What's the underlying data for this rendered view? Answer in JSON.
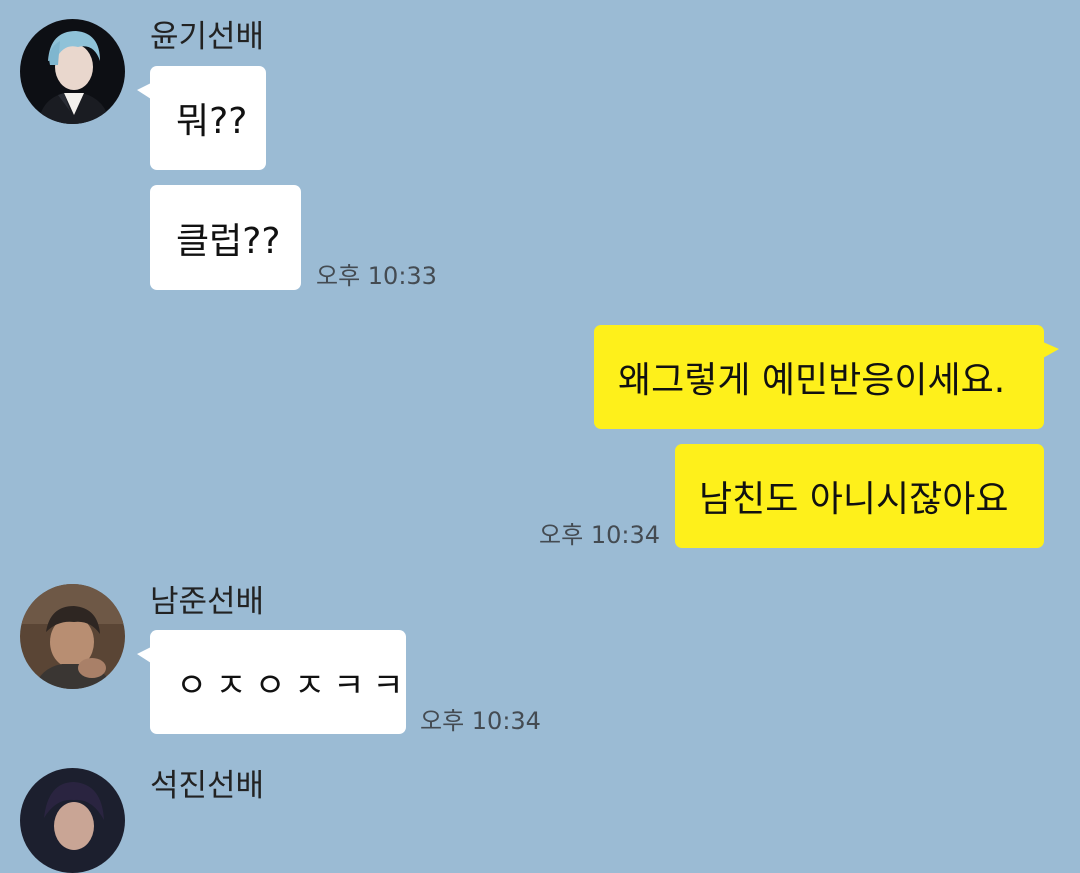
{
  "messages": [
    {
      "sender": "윤기선배",
      "bubbles": [
        "뭐??",
        "클럽??"
      ],
      "time": "오후 10:33"
    },
    {
      "sender": "me",
      "bubbles": [
        "왜그렇게 예민반응이세요.",
        "남친도 아니시잖아요"
      ],
      "time": "오후 10:34"
    },
    {
      "sender": "남준선배",
      "bubbles": [
        "ㅇㅈㅇㅈㅋㅋ"
      ],
      "time": "오후 10:34"
    },
    {
      "sender": "석진선배",
      "bubbles": [],
      "time": ""
    }
  ],
  "colors": {
    "background": "#9bbbd4",
    "received_bubble": "#ffffff",
    "sent_bubble": "#fef01b"
  },
  "icons": {
    "avatar_1": "profile-photo-avatar",
    "avatar_2": "profile-photo-avatar",
    "avatar_3": "profile-photo-avatar"
  }
}
